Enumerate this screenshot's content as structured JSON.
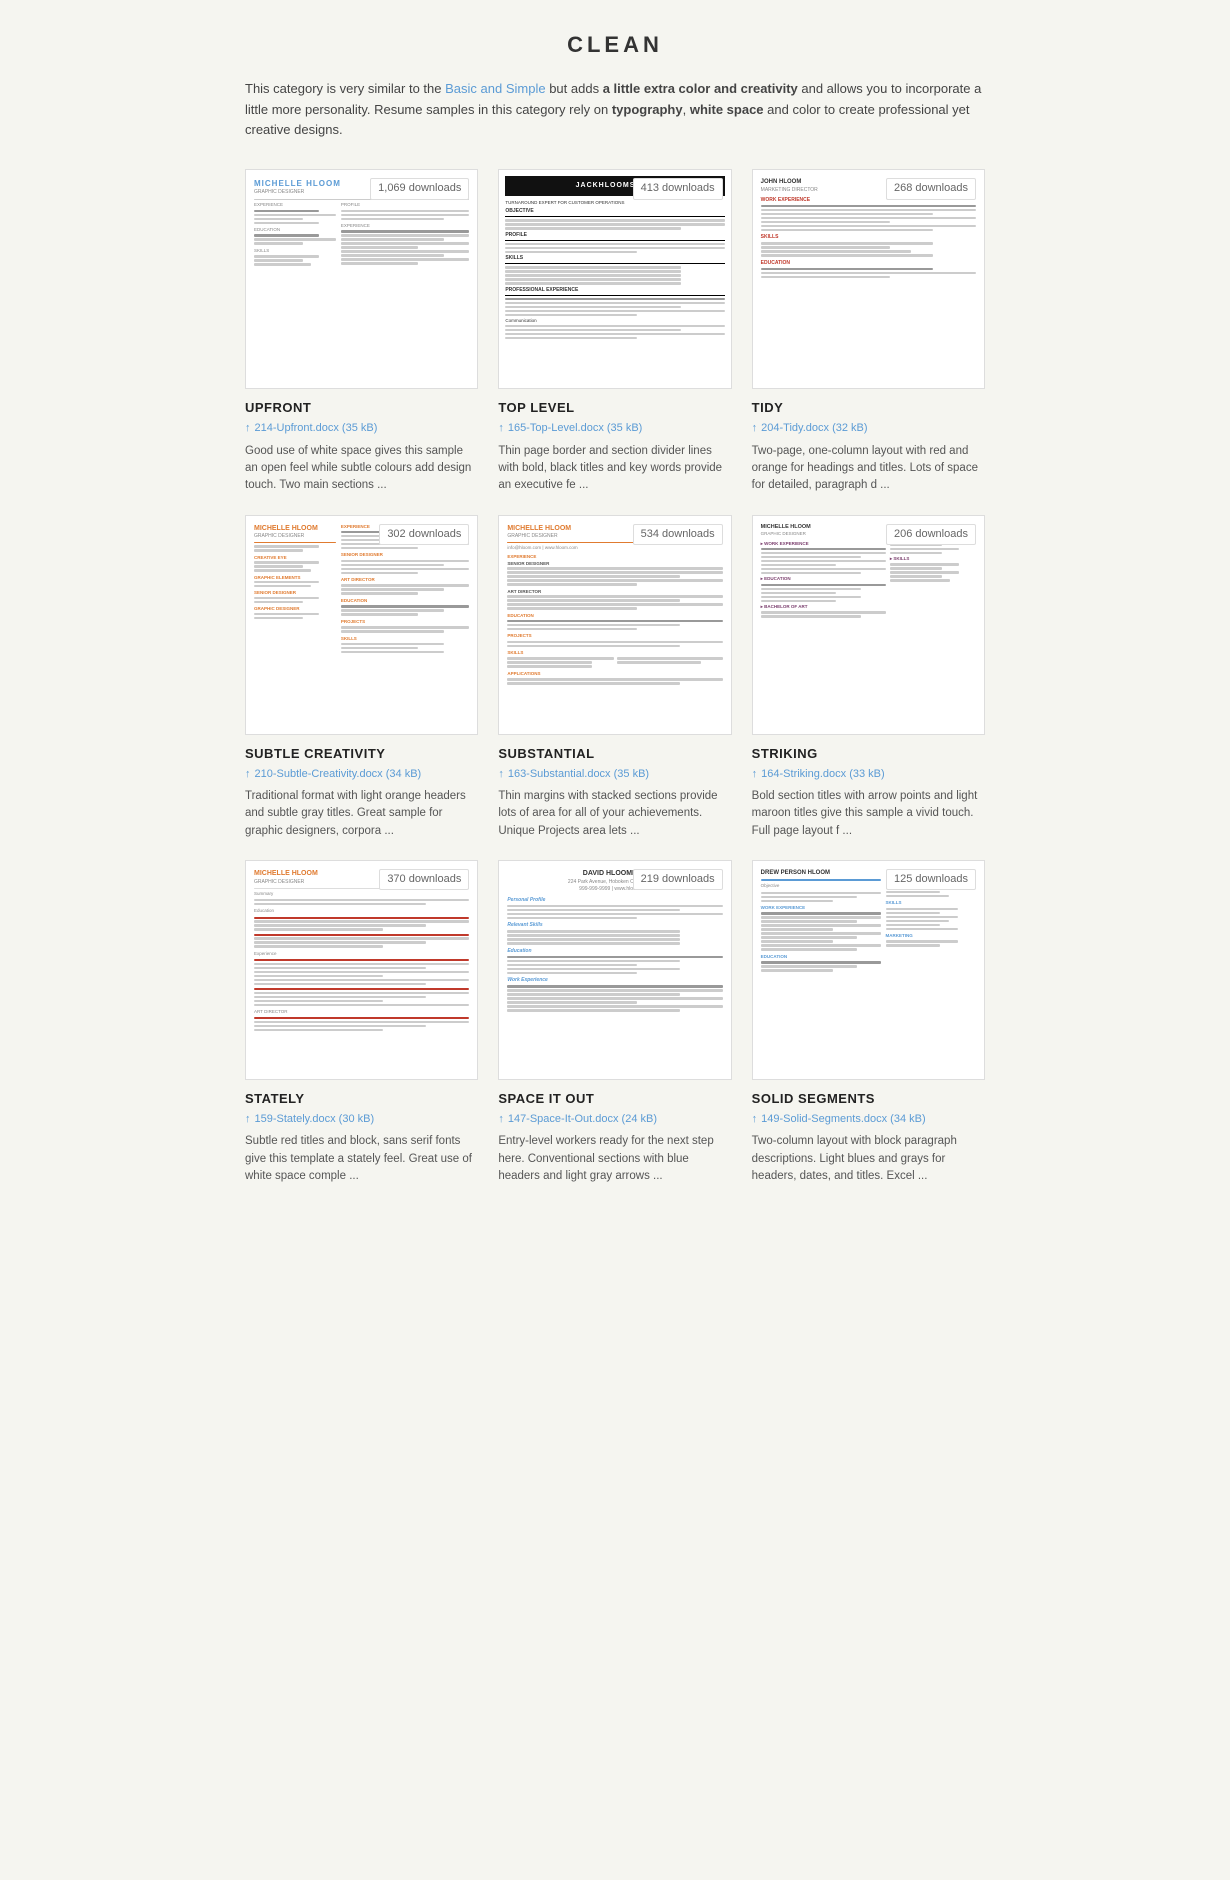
{
  "page": {
    "title": "CLEAN",
    "intro": {
      "text_before_link": "This category is very similar to the ",
      "link_text": "Basic and Simple",
      "text_after_link": " but adds ",
      "bold_text": "a little extra color and creativity",
      "text_rest": " and allows you to incorporate a little more personality. Resume samples in this category rely on ",
      "bold2": "typography",
      "text_mid": ", ",
      "bold3": "white space",
      "text_end": " and color to create professional yet creative designs."
    }
  },
  "cards": [
    {
      "id": "upfront",
      "title": "UPFRONT",
      "downloads": "1,069 downloads",
      "file": "214-Upfront.docx (35 kB)",
      "description": "Good use of white space gives this sample an open feel while subtle colours add design touch. Two main sections ..."
    },
    {
      "id": "toplevel",
      "title": "TOP LEVEL",
      "downloads": "413 downloads",
      "file": "165-Top-Level.docx (35 kB)",
      "description": "Thin page border and section divider lines with bold, black titles and key words provide an executive fe ..."
    },
    {
      "id": "tidy",
      "title": "TIDY",
      "downloads": "268 downloads",
      "file": "204-Tidy.docx (32 kB)",
      "description": "Two-page, one-column layout with red and orange for headings and titles. Lots of space for detailed, paragraph d ..."
    },
    {
      "id": "subtle-creativity",
      "title": "SUBTLE CREATIVITY",
      "downloads": "302 downloads",
      "file": "210-Subtle-Creativity.docx (34 kB)",
      "description": "Traditional format with light orange headers and subtle gray titles. Great sample for graphic designers, corpora ..."
    },
    {
      "id": "substantial",
      "title": "SUBSTANTIAL",
      "downloads": "534 downloads",
      "file": "163-Substantial.docx (35 kB)",
      "description": "Thin margins with stacked sections provide lots of area for all of your achievements. Unique Projects area lets ..."
    },
    {
      "id": "striking",
      "title": "STRIKING",
      "downloads": "206 downloads",
      "file": "164-Striking.docx (33 kB)",
      "description": "Bold section titles with arrow points and light maroon titles give this sample a vivid touch. Full page layout f ..."
    },
    {
      "id": "stately",
      "title": "STATELY",
      "downloads": "370 downloads",
      "file": "159-Stately.docx (30 kB)",
      "description": "Subtle red titles and block, sans serif fonts give this template a stately feel. Great use of white space comple ..."
    },
    {
      "id": "space-it-out",
      "title": "SPACE IT OUT",
      "downloads": "219 downloads",
      "file": "147-Space-It-Out.docx (24 kB)",
      "description": "Entry-level workers ready for the next step here. Conventional sections with blue headers and light gray arrows ..."
    },
    {
      "id": "solid-segments",
      "title": "SOLID SEGMENTS",
      "downloads": "125 downloads",
      "file": "149-Solid-Segments.docx (34 kB)",
      "description": "Two-column layout with block paragraph descriptions. Light blues and grays for headers, dates, and titles. Excel ..."
    }
  ]
}
